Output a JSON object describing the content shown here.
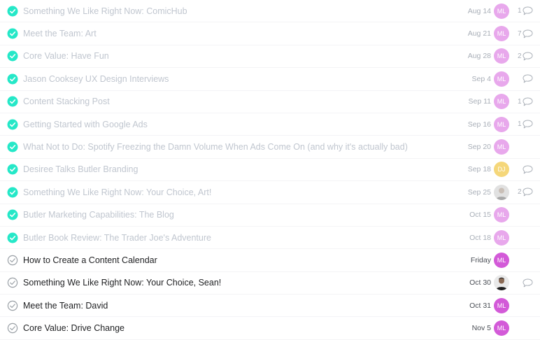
{
  "colors": {
    "check_done": "#25e8c8",
    "check_open": "#9aa0a6",
    "avatar_ml_done": "#e8a8ec",
    "avatar_ml_open": "#d35ad8",
    "avatar_dj": "#f5d77a",
    "comment_icon": "#aab0b8"
  },
  "tasks": [
    {
      "title": "Something We Like Right Now: ComicHub",
      "date": "Aug 14",
      "status": "done",
      "avatar": "ML",
      "avatar_kind": "initials",
      "comments": "1"
    },
    {
      "title": "Meet the Team: Art",
      "date": "Aug 21",
      "status": "done",
      "avatar": "ML",
      "avatar_kind": "initials",
      "comments": "7"
    },
    {
      "title": "Core Value: Have Fun",
      "date": "Aug 28",
      "status": "done",
      "avatar": "ML",
      "avatar_kind": "initials",
      "comments": "2"
    },
    {
      "title": "Jason Cooksey UX Design Interviews",
      "date": "Sep 4",
      "status": "done",
      "avatar": "ML",
      "avatar_kind": "initials",
      "comments": ""
    },
    {
      "title": "Content Stacking Post",
      "date": "Sep 11",
      "status": "done",
      "avatar": "ML",
      "avatar_kind": "initials",
      "comments": "1"
    },
    {
      "title": "Getting Started with Google Ads",
      "date": "Sep 16",
      "status": "done",
      "avatar": "ML",
      "avatar_kind": "initials",
      "comments": "1"
    },
    {
      "title": "What Not to Do: Spotify Freezing the Damn Volume When Ads Come On (and why it's actually bad)",
      "date": "Sep 20",
      "status": "done",
      "avatar": "ML",
      "avatar_kind": "initials",
      "comments": null
    },
    {
      "title": "Desiree Talks Butler Branding",
      "date": "Sep 18",
      "status": "done",
      "avatar": "DJ",
      "avatar_kind": "initials-yellow",
      "comments": ""
    },
    {
      "title": "Something We Like Right Now: Your Choice, Art!",
      "date": "Sep 25",
      "status": "done",
      "avatar": "",
      "avatar_kind": "photo-gray",
      "comments": "2"
    },
    {
      "title": "Butler Marketing Capabilities: The Blog",
      "date": "Oct 15",
      "status": "done",
      "avatar": "ML",
      "avatar_kind": "initials",
      "comments": null
    },
    {
      "title": "Butler Book Review: The Trader Joe's Adventure",
      "date": "Oct 18",
      "status": "done",
      "avatar": "ML",
      "avatar_kind": "initials",
      "comments": null
    },
    {
      "title": "How to Create a Content Calendar",
      "date": "Friday",
      "status": "open",
      "avatar": "ML",
      "avatar_kind": "initials",
      "comments": null
    },
    {
      "title": "Something We Like Right Now: Your Choice, Sean!",
      "date": "Oct 30",
      "status": "open",
      "avatar": "",
      "avatar_kind": "photo-dark",
      "comments": ""
    },
    {
      "title": "Meet the Team: David",
      "date": "Oct 31",
      "status": "open",
      "avatar": "ML",
      "avatar_kind": "initials",
      "comments": null
    },
    {
      "title": "Core Value: Drive Change",
      "date": "Nov 5",
      "status": "open",
      "avatar": "ML",
      "avatar_kind": "initials",
      "comments": null
    }
  ]
}
